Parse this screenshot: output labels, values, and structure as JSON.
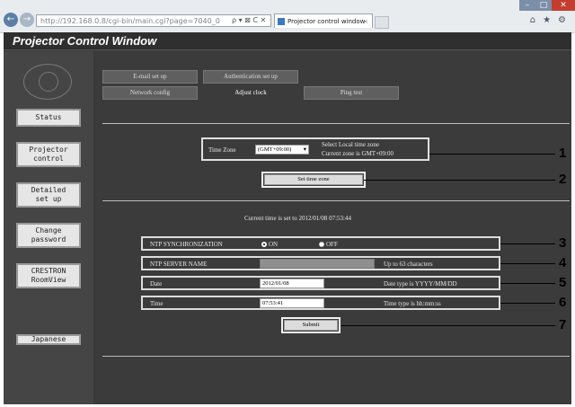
{
  "browser": {
    "url": "http://192.168.0.8/cgi-bin/main.cgi?page=7040_0",
    "tab_title": "Projector control window",
    "window_controls": {
      "minimize": "–",
      "maximize": "□",
      "close": "✕"
    },
    "icons": {
      "back": "back-arrow-icon",
      "forward": "forward-arrow-icon",
      "search": "search-icon",
      "refresh": "refresh-icon",
      "stop": "stop-icon",
      "home": "home-icon",
      "favorites": "star-icon",
      "settings": "gear-icon"
    },
    "glyphs": {
      "back": "←",
      "forward": "→",
      "address_icons": "ρ ▾ ⊠ C ✕",
      "tab_close": "×",
      "home": "⌂",
      "star": "★",
      "gear": "⚙"
    }
  },
  "app": {
    "title": "Projector Control Window",
    "sidebar": [
      {
        "label": "Status"
      },
      {
        "label": "Projector\ncontrol"
      },
      {
        "label": "Detailed\nset up"
      },
      {
        "label": "Change\npassword"
      },
      {
        "label": "CRESTRON\nRoomView"
      },
      {
        "label": "Japanese"
      }
    ],
    "tabs_row1": [
      {
        "label": "E-mail set up"
      },
      {
        "label": "Authentication set up"
      }
    ],
    "tabs_row2": [
      {
        "label": "Network config"
      },
      {
        "label": "Adjust clock",
        "active": true
      },
      {
        "label": "Ping test"
      }
    ],
    "time_zone": {
      "label": "Time Zone",
      "selected": "(GMT+09:00)",
      "help_line1": "Select Local time zone",
      "help_line2": "Current zone is GMT+09:00"
    },
    "set_time_zone_button": "Set time zone",
    "current_time": "Current time is set to 2012/01/08 07:53:44",
    "ntp_sync": {
      "label": "NTP SYNCHRONIZATION",
      "on_label": "ON",
      "off_label": "OFF",
      "selected": "ON"
    },
    "ntp_server": {
      "label": "NTP SERVER NAME",
      "value": "",
      "hint": "Up to 63 characters"
    },
    "date": {
      "label": "Date",
      "value": "2012/01/08",
      "hint": "Date type is YYYY/MM/DD"
    },
    "time": {
      "label": "Time",
      "value": "07:53:41",
      "hint": "Time type is hh:mm:ss"
    },
    "submit_button": "Submit"
  },
  "callouts": [
    "1",
    "2",
    "3",
    "4",
    "5",
    "6",
    "7"
  ]
}
